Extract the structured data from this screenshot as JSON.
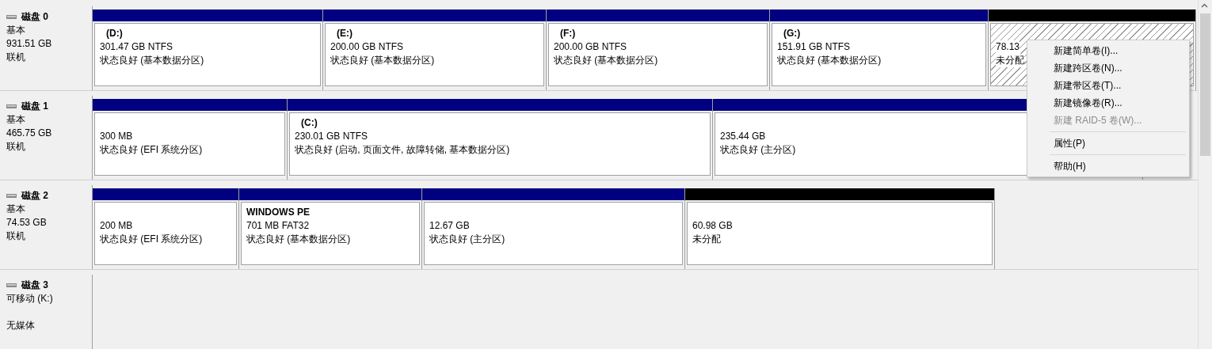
{
  "disks": [
    {
      "name": "磁盘 0",
      "type": "基本",
      "size": "931.51 GB",
      "status": "联机",
      "partitions": [
        {
          "kind": "primary",
          "label": "(D:)",
          "size": "301.47 GB NTFS",
          "status": "状态良好 (基本数据分区)",
          "selected": false
        },
        {
          "kind": "primary",
          "label": "(E:)",
          "size": "200.00 GB NTFS",
          "status": "状态良好 (基本数据分区)",
          "selected": false
        },
        {
          "kind": "primary",
          "label": "(F:)",
          "size": "200.00 GB NTFS",
          "status": "状态良好 (基本数据分区)",
          "selected": false
        },
        {
          "kind": "primary",
          "label": "(G:)",
          "size": "151.91 GB NTFS",
          "status": "状态良好 (基本数据分区)",
          "selected": false
        },
        {
          "kind": "unallocated",
          "size": "78.13",
          "status": "未分配",
          "selected": true
        }
      ]
    },
    {
      "name": "磁盘 1",
      "type": "基本",
      "size": "465.75 GB",
      "status": "联机",
      "partitions": [
        {
          "kind": "primary",
          "size": "300 MB",
          "status": "状态良好 (EFI 系统分区)",
          "selected": false
        },
        {
          "kind": "primary",
          "label": "(C:)",
          "size": "230.01 GB NTFS",
          "status": "状态良好 (启动, 页面文件, 故障转储, 基本数据分区)",
          "selected": false
        },
        {
          "kind": "primary",
          "size": "235.44 GB",
          "status": "状态良好 (主分区)",
          "selected": false
        }
      ]
    },
    {
      "name": "磁盘 2",
      "type": "基本",
      "size": "74.53 GB",
      "status": "联机",
      "partitions": [
        {
          "kind": "primary",
          "size": "200 MB",
          "status": "状态良好 (EFI 系统分区)",
          "selected": false
        },
        {
          "kind": "primary",
          "label": "WINDOWS PE",
          "size": "701 MB FAT32",
          "status": "状态良好 (基本数据分区)",
          "selected": false
        },
        {
          "kind": "primary",
          "size": "12.67 GB",
          "status": "状态良好 (主分区)",
          "selected": false
        },
        {
          "kind": "unallocated",
          "size": "60.98 GB",
          "status": "未分配",
          "selected": false
        }
      ]
    },
    {
      "name": "磁盘 3",
      "type": "可移动 (K:)",
      "status": "无媒体"
    }
  ],
  "context_menu": [
    {
      "kind": "item",
      "label": "新建简单卷(I)...",
      "disabled": false
    },
    {
      "kind": "item",
      "label": "新建跨区卷(N)...",
      "disabled": false
    },
    {
      "kind": "item",
      "label": "新建带区卷(T)...",
      "disabled": false
    },
    {
      "kind": "item",
      "label": "新建镜像卷(R)...",
      "disabled": false
    },
    {
      "kind": "item",
      "label": "新建 RAID-5 卷(W)...",
      "disabled": true
    },
    {
      "kind": "separator"
    },
    {
      "kind": "item",
      "label": "属性(P)",
      "disabled": false
    },
    {
      "kind": "separator"
    },
    {
      "kind": "item",
      "label": "帮助(H)",
      "disabled": false
    }
  ]
}
